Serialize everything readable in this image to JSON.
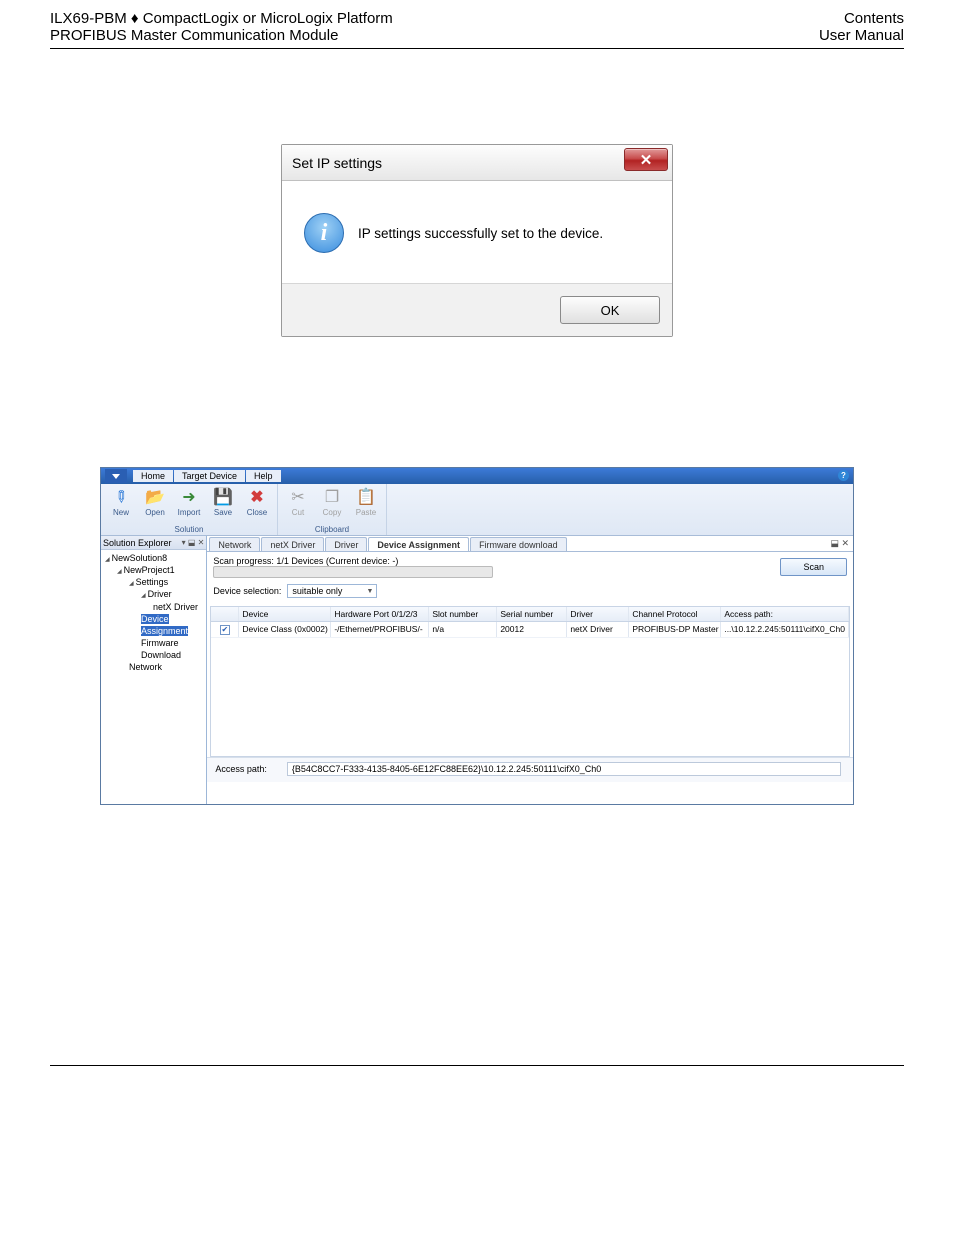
{
  "header": {
    "left_line1": "ILX69-PBM ♦ CompactLogix or MicroLogix Platform",
    "left_line2": "PROFIBUS Master Communication Module",
    "right_line1": "Contents",
    "right_line2": "User Manual"
  },
  "dialog1": {
    "title": "Set IP settings",
    "close_glyph": "✕",
    "info_glyph": "i",
    "message": "IP settings successfully set to the device.",
    "ok_label": "OK"
  },
  "shot2": {
    "menubar": {
      "home": "Home",
      "target_device": "Target Device",
      "help": "Help",
      "help_icon": "?"
    },
    "ribbon": {
      "solution": {
        "label": "Solution",
        "items": [
          {
            "name": "New",
            "glyph": "✎"
          },
          {
            "name": "Open",
            "glyph": "📂"
          },
          {
            "name": "Import",
            "glyph": "➜"
          },
          {
            "name": "Save",
            "glyph": "💾"
          },
          {
            "name": "Close",
            "glyph": "✖"
          }
        ]
      },
      "clipboard": {
        "label": "Clipboard",
        "items": [
          {
            "name": "Cut",
            "glyph": "✂"
          },
          {
            "name": "Copy",
            "glyph": "❐"
          },
          {
            "name": "Paste",
            "glyph": "📋"
          }
        ]
      }
    },
    "solution_explorer": {
      "title": "Solution Explorer",
      "pin_glyph": "▾ ⬓ ✕",
      "tree": {
        "n0": "NewSolution8",
        "n1": "NewProject1",
        "n2": "Settings",
        "n3": "Driver",
        "n4": "netX Driver",
        "n5": "Device Assignment",
        "n6": "Firmware Download",
        "n7": "Network"
      }
    },
    "tabs": {
      "t0": "Network",
      "t1": "netX Driver",
      "t2": "Driver",
      "t3": "Device Assignment",
      "t4": "Firmware download",
      "pin": "⬓ ✕"
    },
    "scan": {
      "progress_label": "Scan progress: 1/1 Devices (Current device: -)",
      "selection_label": "Device selection:",
      "selection_value": "suitable only",
      "scan_btn": "Scan"
    },
    "table": {
      "headers": {
        "h0": "",
        "h1": "Device",
        "h2": "Hardware Port 0/1/2/3",
        "h3": "Slot number",
        "h4": "Serial number",
        "h5": "Driver",
        "h6": "Channel Protocol",
        "h7": "Access path:"
      },
      "row0": {
        "checked": "✔",
        "device": "Device Class (0x0002)",
        "hw": "-/Ethernet/PROFIBUS/-",
        "slot": "n/a",
        "serial": "20012",
        "driver": "netX Driver",
        "protocol": "PROFIBUS-DP Master",
        "access": "...\\10.12.2.245:50111\\cifX0_Ch0"
      }
    },
    "access_path": {
      "label": "Access path:",
      "value": "{B54C8CC7-F333-4135-8405-6E12FC88EE62}\\10.12.2.245:50111\\cifX0_Ch0"
    }
  }
}
